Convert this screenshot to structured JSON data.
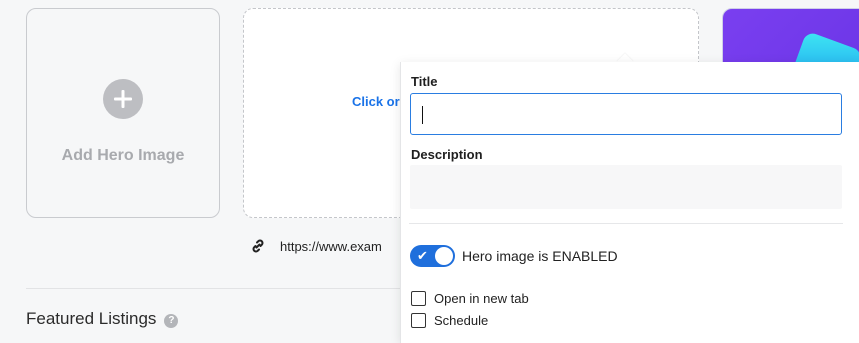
{
  "hero_add": {
    "label": "Add Hero Image",
    "icon": "plus-circle-icon"
  },
  "upload": {
    "cta": "Click or"
  },
  "url": {
    "text": "https://www.exam",
    "icon": "link-icon"
  },
  "featured": {
    "title": "Featured Listings",
    "help": "?"
  },
  "popover": {
    "title_label": "Title",
    "title_value": "",
    "description_label": "Description",
    "description_value": "",
    "toggle_label": "Hero image is ENABLED",
    "toggle_on": true,
    "open_new_tab_label": "Open in new tab",
    "schedule_label": "Schedule"
  },
  "colors": {
    "accent": "#1f6fdc",
    "link": "#1a73e8"
  }
}
